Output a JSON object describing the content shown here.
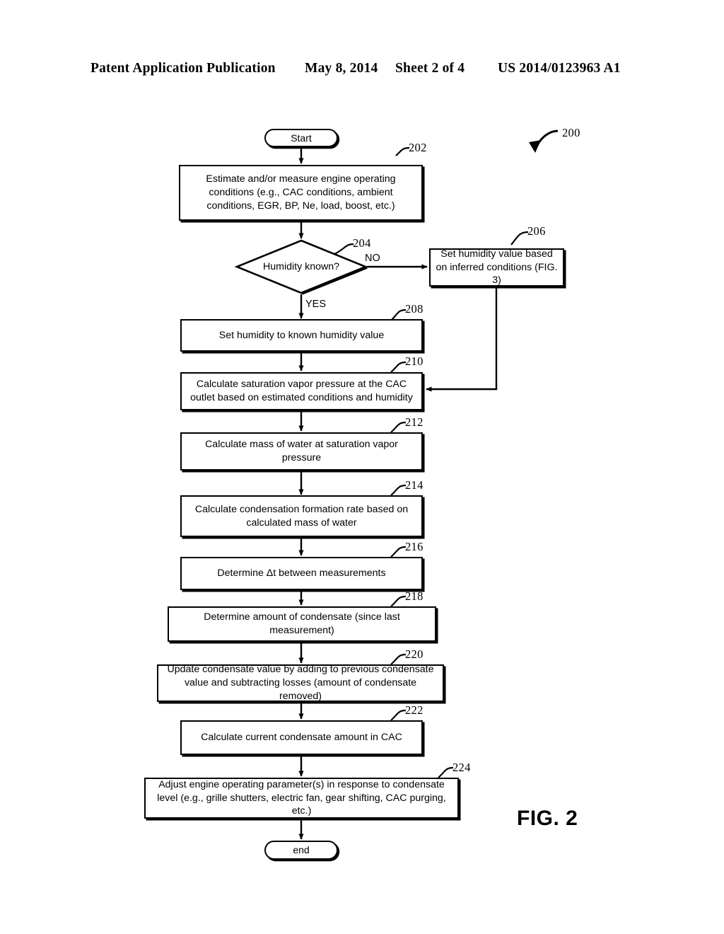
{
  "header": {
    "publication": "Patent Application Publication",
    "date": "May 8, 2014",
    "sheet": "Sheet 2 of 4",
    "patent_number": "US 2014/0123963 A1"
  },
  "figure": {
    "caption": "FIG. 2",
    "diagram_ref": "200"
  },
  "flow": {
    "start_label": "Start",
    "end_label": "end",
    "edge_yes": "YES",
    "edge_no": "NO",
    "nodes": [
      {
        "id": "202",
        "ref": "202",
        "type": "process",
        "text": "Estimate and/or measure engine operating conditions (e.g., CAC conditions, ambient conditions, EGR, BP, Ne, load, boost, etc.)"
      },
      {
        "id": "204",
        "ref": "204",
        "type": "decision",
        "text": "Humidity known?"
      },
      {
        "id": "206",
        "ref": "206",
        "type": "process",
        "text": "Set humidity value based on inferred conditions (FIG. 3)"
      },
      {
        "id": "208",
        "ref": "208",
        "type": "process",
        "text": "Set humidity to known humidity value"
      },
      {
        "id": "210",
        "ref": "210",
        "type": "process",
        "text": "Calculate saturation vapor pressure at the CAC outlet based on estimated conditions and humidity"
      },
      {
        "id": "212",
        "ref": "212",
        "type": "process",
        "text": "Calculate mass of water at saturation vapor pressure"
      },
      {
        "id": "214",
        "ref": "214",
        "type": "process",
        "text": "Calculate condensation formation rate based on calculated mass of water"
      },
      {
        "id": "216",
        "ref": "216",
        "type": "process",
        "text": "Determine Δt between measurements"
      },
      {
        "id": "218",
        "ref": "218",
        "type": "process",
        "text": "Determine amount of condensate (since last measurement)"
      },
      {
        "id": "220",
        "ref": "220",
        "type": "process",
        "text": "Update condensate value by adding to previous condensate value and subtracting losses (amount of condensate removed)"
      },
      {
        "id": "222",
        "ref": "222",
        "type": "process",
        "text": "Calculate current condensate amount in CAC"
      },
      {
        "id": "224",
        "ref": "224",
        "type": "process",
        "text": "Adjust engine operating parameter(s) in response to condensate level (e.g., grille shutters, electric fan, gear shifting, CAC purging, etc.)"
      }
    ]
  }
}
